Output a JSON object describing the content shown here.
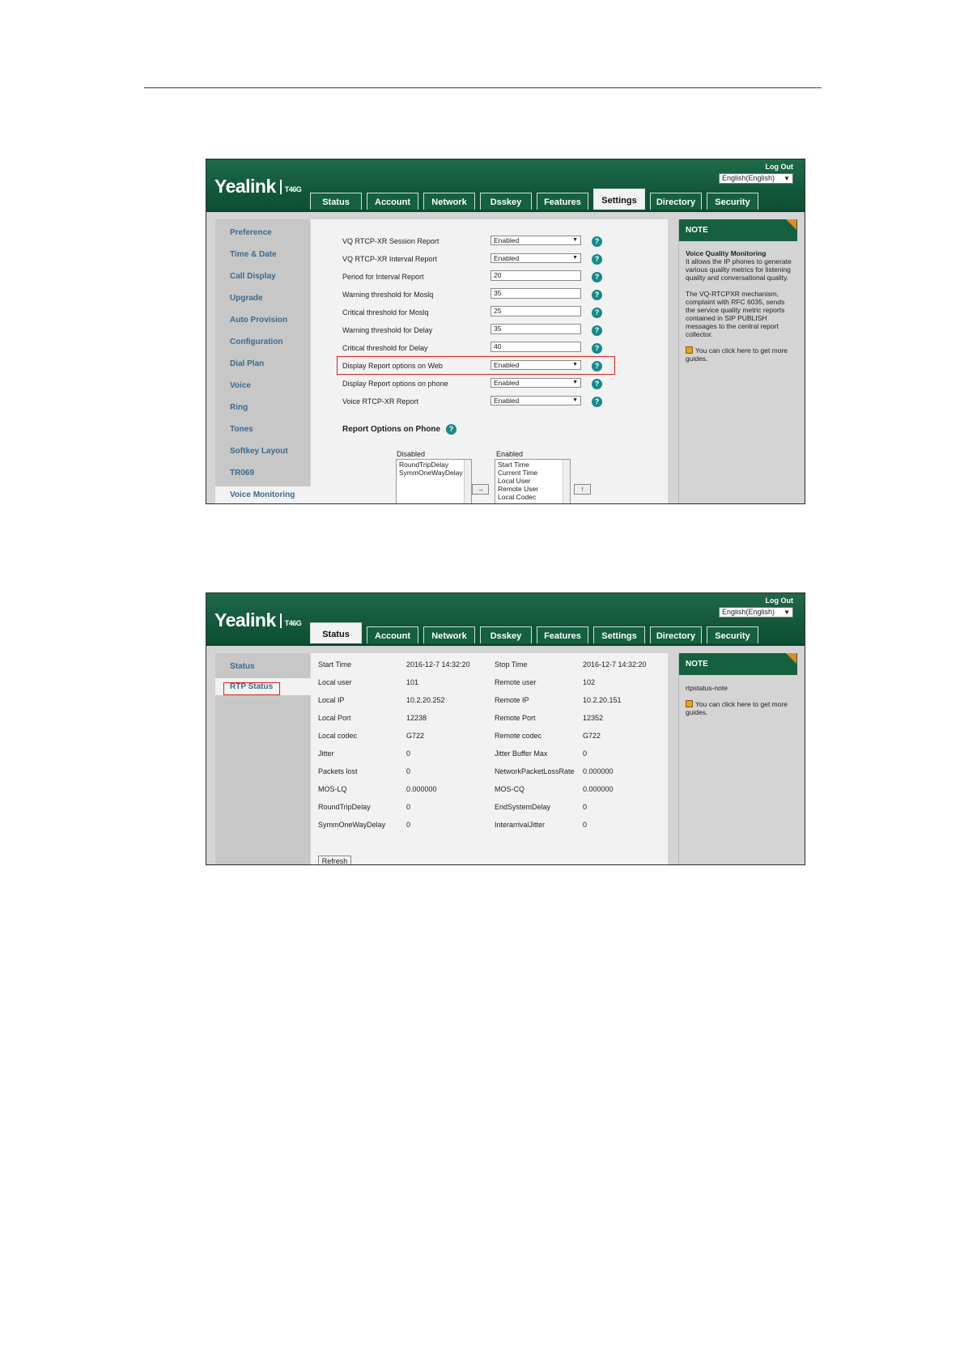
{
  "screen1": {
    "brand": "Yealink",
    "model": "T46G",
    "logout": "Log Out",
    "language": "English(English)",
    "tabs": [
      "Status",
      "Account",
      "Network",
      "Dsskey",
      "Features",
      "Settings",
      "Directory",
      "Security"
    ],
    "active_tab": "Settings",
    "sidebar": [
      "Preference",
      "Time & Date",
      "Call Display",
      "Upgrade",
      "Auto Provision",
      "Configuration",
      "Dial Plan",
      "Voice",
      "Ring",
      "Tones",
      "Softkey Layout",
      "TR069",
      "Voice Monitoring"
    ],
    "active_sidebar": "Voice Monitoring",
    "rows": [
      {
        "label": "VQ RTCP-XR Session Report",
        "value": "Enabled",
        "kind": "select"
      },
      {
        "label": "VQ RTCP-XR Interval Report",
        "value": "Enabled",
        "kind": "select"
      },
      {
        "label": "Period for Interval Report",
        "value": "20",
        "kind": "input"
      },
      {
        "label": "Warning threshold for Moslq",
        "value": "35",
        "kind": "input"
      },
      {
        "label": "Critical threshold for Moslq",
        "value": "25",
        "kind": "input"
      },
      {
        "label": "Warning threshold for Delay",
        "value": "35",
        "kind": "input"
      },
      {
        "label": "Critical threshold for Delay",
        "value": "40",
        "kind": "input"
      },
      {
        "label": "Display Report options on Web",
        "value": "Enabled",
        "kind": "select"
      },
      {
        "label": "Display Report options on phone",
        "value": "Enabled",
        "kind": "select"
      },
      {
        "label": "Voice RTCP-XR Report",
        "value": "Enabled",
        "kind": "select"
      }
    ],
    "help_glyph": "?",
    "report_options_title": "Report Options on Phone",
    "disabled_label": "Disabled",
    "enabled_label": "Enabled",
    "disabled_items": [
      "RoundTripDelay",
      "SymmOneWayDelay"
    ],
    "enabled_items": [
      "Start Time",
      "Current Time",
      "Local User",
      "Remote User",
      "Local Codec"
    ],
    "move_right_glyph": "→",
    "move_up_glyph": "↑",
    "note_title": "NOTE",
    "note_heading": "Voice Quality Monitoring",
    "note_body1": "It allows the IP phones to generate various quality metrics for listening quality and conversational quality.",
    "note_body2": "The VQ-RTCPXR mechanism, complaint with RFC 6035, sends the service quality metric reports contained in SIP PUBLISH messages to the central report collector.",
    "note_guide": "You can click here to get more guides."
  },
  "screen2": {
    "brand": "Yealink",
    "model": "T46G",
    "logout": "Log Out",
    "language": "English(English)",
    "tabs": [
      "Status",
      "Account",
      "Network",
      "Dsskey",
      "Features",
      "Settings",
      "Directory",
      "Security"
    ],
    "active_tab": "Status",
    "sidebar": [
      "Status",
      "RTP Status"
    ],
    "active_sidebar": "RTP Status",
    "rows": [
      {
        "l1": "Start Time",
        "v1": "2016-12-7 14:32:20",
        "l2": "Stop Time",
        "v2": "2016-12-7 14:32:20"
      },
      {
        "l1": "Local user",
        "v1": "101",
        "l2": "Remote user",
        "v2": "102"
      },
      {
        "l1": "Local IP",
        "v1": "10.2.20.252",
        "l2": "Remote IP",
        "v2": "10.2.20.151"
      },
      {
        "l1": "Local Port",
        "v1": "12238",
        "l2": "Remote Port",
        "v2": "12352"
      },
      {
        "l1": "Local codec",
        "v1": "G722",
        "l2": "Remote codec",
        "v2": "G722"
      },
      {
        "l1": "Jitter",
        "v1": "0",
        "l2": "Jitter Buffer Max",
        "v2": "0"
      },
      {
        "l1": "Packets lost",
        "v1": "0",
        "l2": "NetworkPacketLossRate",
        "v2": "0.000000"
      },
      {
        "l1": "MOS-LQ",
        "v1": "0.000000",
        "l2": "MOS-CQ",
        "v2": "0.000000"
      },
      {
        "l1": "RoundTripDelay",
        "v1": "0",
        "l2": "EndSystemDelay",
        "v2": "0"
      },
      {
        "l1": "SymmOneWayDelay",
        "v1": "0",
        "l2": "InterarrivalJitter",
        "v2": "0"
      }
    ],
    "refresh": "Refresh",
    "note_title": "NOTE",
    "note_text": "rtpstatus-note",
    "note_guide": "You can click here to get more guides."
  },
  "colors": {
    "header_green": "#14603f",
    "highlight_red": "#e02020",
    "note_corner": "#e88a1a",
    "sidebar_link": "#3d6a8a"
  }
}
